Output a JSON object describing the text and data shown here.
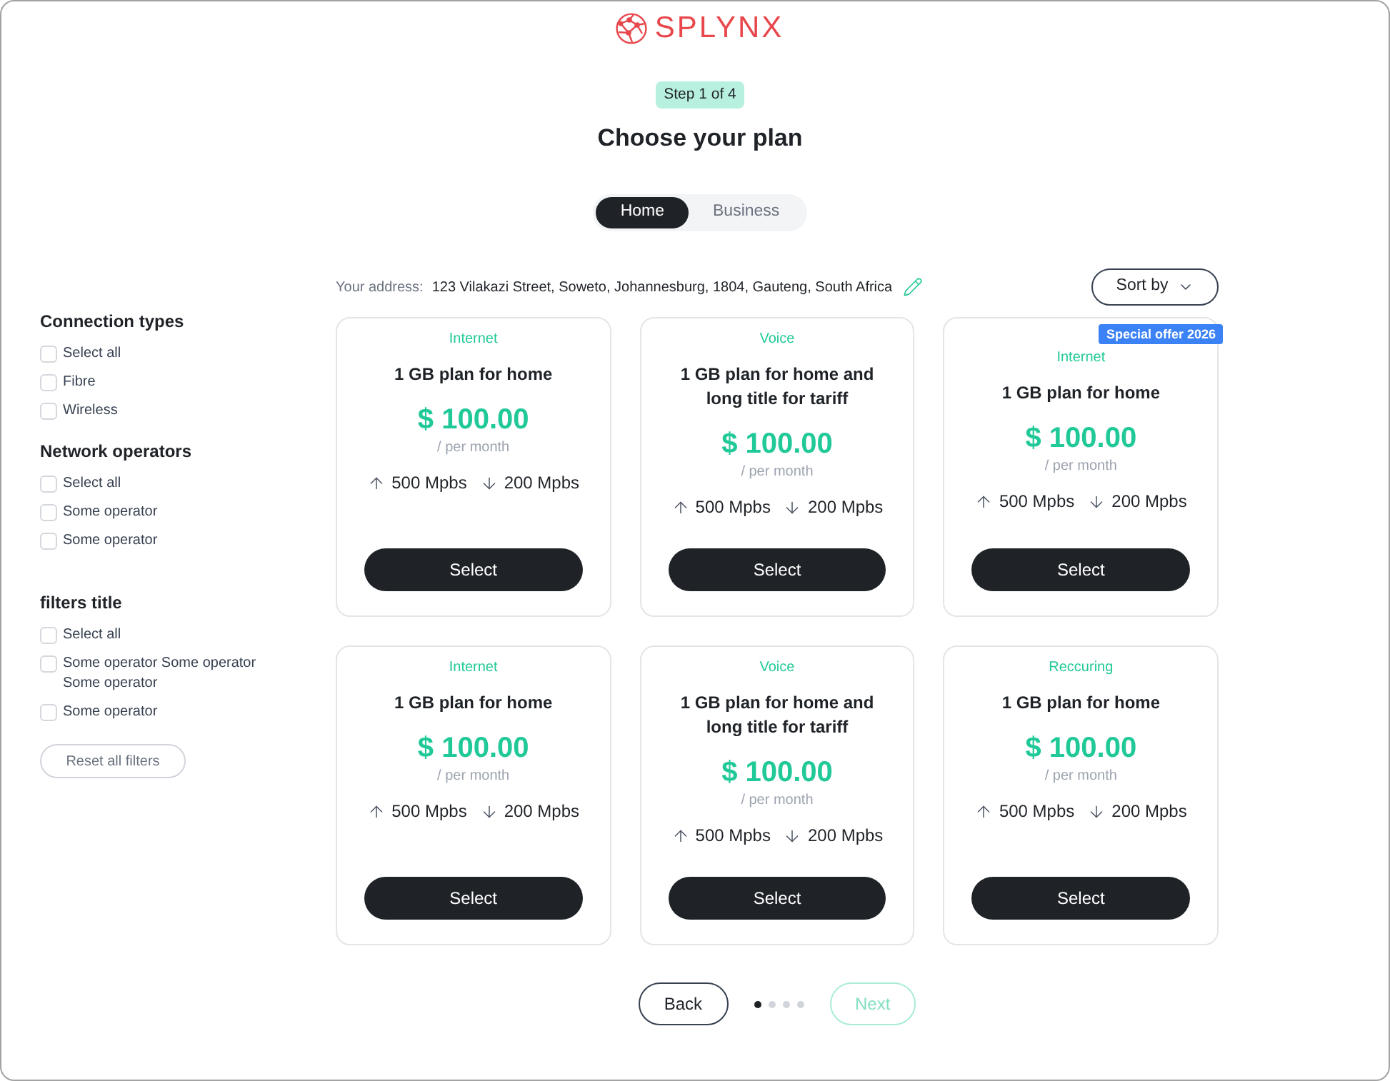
{
  "logo": {
    "text": "SPLYNX"
  },
  "step_badge": "Step 1 of 4",
  "title": "Choose your plan",
  "segments": [
    {
      "label": "Home",
      "selected": true
    },
    {
      "label": "Business",
      "selected": false
    }
  ],
  "filters": [
    {
      "title": "Connection types",
      "options": [
        {
          "label": "Select all",
          "checked": false
        },
        {
          "label": "Fibre",
          "checked": false
        },
        {
          "label": "Wireless",
          "checked": false
        }
      ]
    },
    {
      "title": "Network operators",
      "options": [
        {
          "label": "Select all",
          "checked": false
        },
        {
          "label": "Some operator",
          "checked": false
        },
        {
          "label": "Some operator",
          "checked": false
        }
      ]
    },
    {
      "title": "filters title",
      "options": [
        {
          "label": "Select all",
          "checked": false
        },
        {
          "label": "Some operator Some operator Some operator",
          "checked": false
        },
        {
          "label": "Some operator",
          "checked": false
        }
      ]
    }
  ],
  "reset_button": "Reset all filters",
  "address": {
    "label": "Your address:",
    "value": "123 Vilakazi Street, Soweto, Johannesburg, 1804, Gauteng, South Africa"
  },
  "sort_button": "Sort by",
  "plans": [
    {
      "category": "Internet",
      "title": "1 GB plan for home",
      "price": "$ 100.00",
      "period": "/ per month",
      "upload": "500 Mpbs",
      "download": "200 Mpbs",
      "button": "Select"
    },
    {
      "category": "Voice",
      "title": "1 GB plan for home and long title for tariff",
      "price": "$ 100.00",
      "period": "/ per month",
      "upload": "500 Mpbs",
      "download": "200 Mpbs",
      "button": "Select"
    },
    {
      "badge": "Special offer 2026",
      "category": "Internet",
      "title": "1 GB plan for home",
      "price": "$ 100.00",
      "period": "/ per month",
      "upload": "500 Mpbs",
      "download": "200 Mpbs",
      "button": "Select"
    },
    {
      "category": "Internet",
      "title": "1 GB plan for home",
      "price": "$ 100.00",
      "period": "/ per month",
      "upload": "500 Mpbs",
      "download": "200 Mpbs",
      "button": "Select"
    },
    {
      "category": "Voice",
      "title": "1 GB plan for home and long title for tariff",
      "price": "$ 100.00",
      "period": "/ per month",
      "upload": "500 Mpbs",
      "download": "200 Mpbs",
      "button": "Select"
    },
    {
      "category": "Reccuring",
      "title": "1 GB plan for home",
      "price": "$ 100.00",
      "period": "/ per month",
      "upload": "500 Mpbs",
      "download": "200 Mpbs",
      "button": "Select"
    }
  ],
  "pagination": {
    "back": {
      "label": "Back",
      "disabled": false
    },
    "dots": [
      {
        "selected": true
      },
      {
        "selected": false
      },
      {
        "selected": false
      },
      {
        "selected": false
      }
    ],
    "next": {
      "label": "Next",
      "disabled": true
    }
  }
}
